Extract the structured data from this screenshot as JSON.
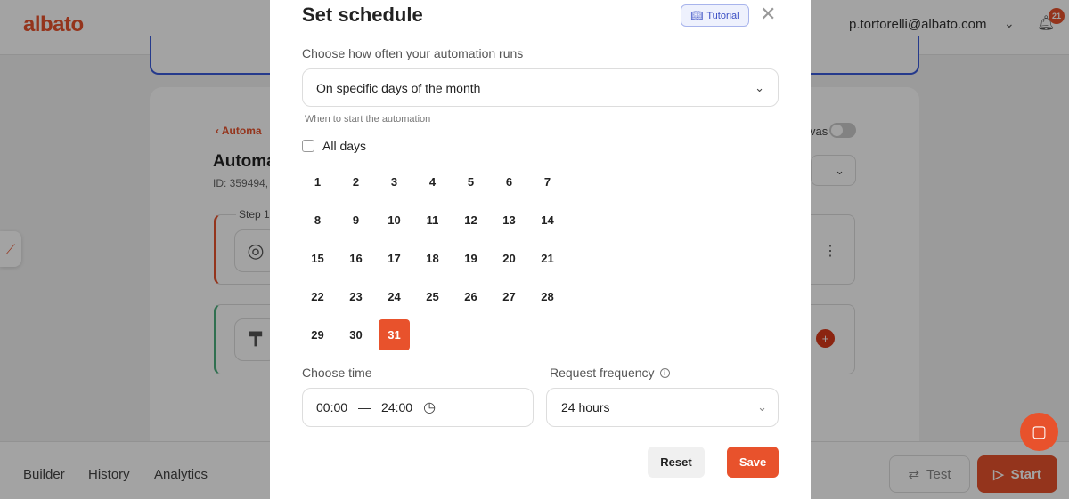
{
  "app": {
    "logo": "albato",
    "user_email": "p.tortorelli@albato.com",
    "notification_count": "21"
  },
  "background": {
    "breadcrumb": "Automa",
    "title": "Automa",
    "id_text": "ID: 359494,",
    "step_label": "Step 1",
    "toggle_label": "vas",
    "bottom_tabs": [
      "Builder",
      "History",
      "Analytics"
    ],
    "test_label": "Test",
    "start_label": "Start"
  },
  "modal": {
    "title": "Set schedule",
    "tutorial_label": "Tutorial",
    "frequency_question": "Choose how often your automation runs",
    "frequency_value": "On specific days of the month",
    "hint": "When to start the automation",
    "all_days_label": "All days",
    "days": [
      "1",
      "2",
      "3",
      "4",
      "5",
      "6",
      "7",
      "8",
      "9",
      "10",
      "11",
      "12",
      "13",
      "14",
      "15",
      "16",
      "17",
      "18",
      "19",
      "20",
      "21",
      "22",
      "23",
      "24",
      "25",
      "26",
      "27",
      "28",
      "29",
      "30",
      "31"
    ],
    "selected_days": [
      "31"
    ],
    "time_label": "Choose time",
    "time_from": "00:00",
    "time_sep": "—",
    "time_to": "24:00",
    "request_freq_label": "Request frequency",
    "request_freq_value": "24 hours",
    "reset_label": "Reset",
    "save_label": "Save"
  },
  "colors": {
    "accent": "#e8522c",
    "tutorial_bg": "#eef1fd",
    "tutorial_text": "#3b4fc4"
  }
}
